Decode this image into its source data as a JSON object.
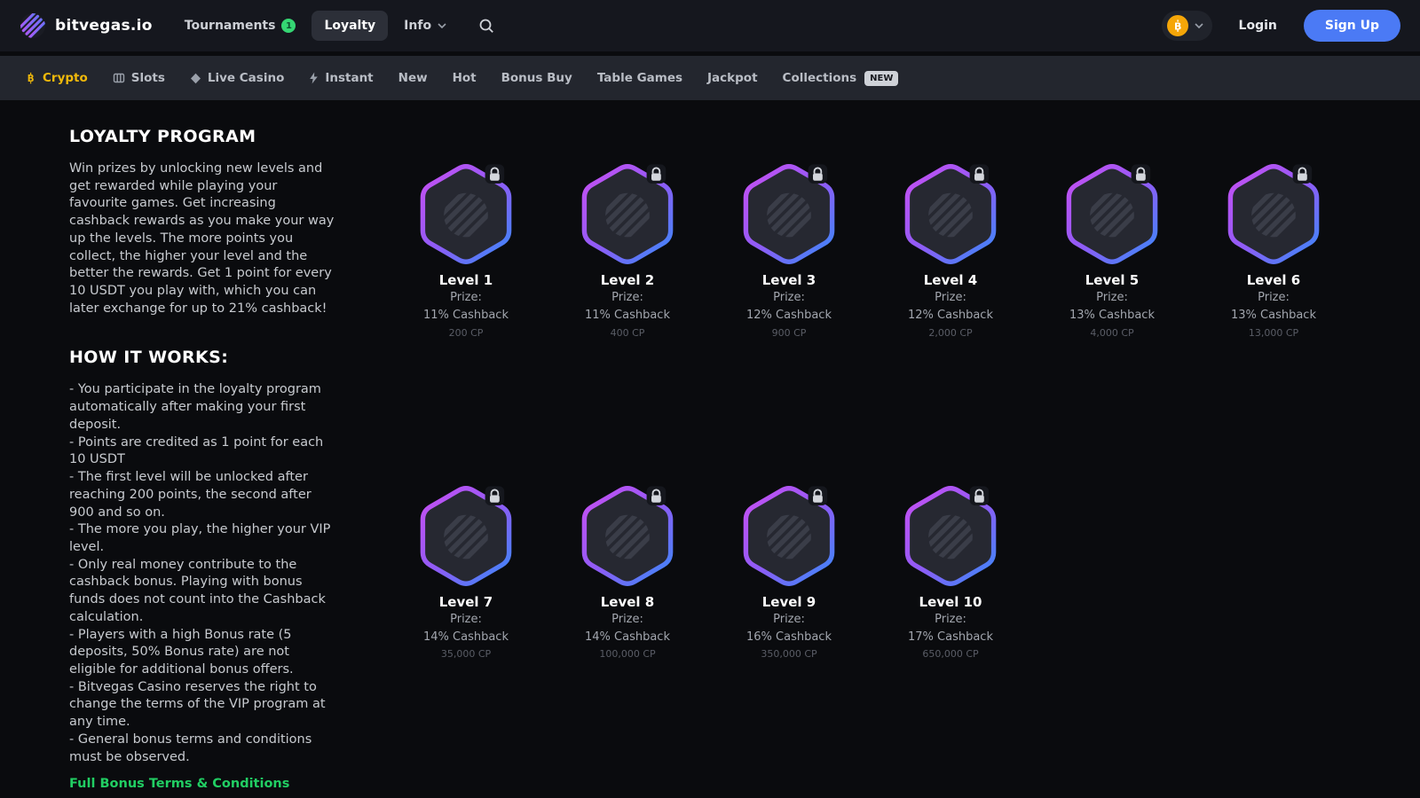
{
  "header": {
    "brand": "bitvegas.io",
    "tournaments_label": "Tournaments",
    "tournaments_badge": "1",
    "loyalty_label": "Loyalty",
    "info_label": "Info",
    "login_label": "Login",
    "signup_label": "Sign Up"
  },
  "subnav": {
    "crypto": "Crypto",
    "slots": "Slots",
    "live_casino": "Live Casino",
    "instant": "Instant",
    "new": "New",
    "hot": "Hot",
    "bonus_buy": "Bonus Buy",
    "table_games": "Table Games",
    "jackpot": "Jackpot",
    "collections": "Collections",
    "collections_badge": "NEW"
  },
  "loyalty_page": {
    "title": "LOYALTY PROGRAM",
    "intro": "Win prizes by unlocking new levels and get rewarded while playing your favourite games. Get increasing cashback rewards as you make your way up the levels. The more points you collect, the higher your level and the better the rewards. Get 1 point for every 10 USDT you play with, which you can later exchange for up to 21% cashback!",
    "how_title": "HOW IT WORKS:",
    "how_items": [
      "- You participate in the loyalty program automatically after making your first deposit.",
      "- Points are credited as 1 point for each 10 USDT",
      "- The first level will be unlocked after reaching 200 points, the second after 900 and so on.",
      "- The more you play, the higher your VIP level.",
      "- Only real money contribute to the cashback bonus. Playing with bonus funds does not count into the Cashback calculation.",
      "- Players with a high Bonus rate (5 deposits, 50% Bonus rate) are not eligible for additional bonus offers.",
      "- Bitvegas Casino reserves the right to change the terms of the VIP program at any time.",
      "- General bonus terms and conditions must be observed."
    ],
    "terms_link": "Full Bonus Terms & Conditions"
  },
  "levels": [
    {
      "name": "Level 1",
      "prize_label": "Prize:",
      "cashback": "11% Cashback",
      "cp": "200 CP"
    },
    {
      "name": "Level 2",
      "prize_label": "Prize:",
      "cashback": "11% Cashback",
      "cp": "400 CP"
    },
    {
      "name": "Level 3",
      "prize_label": "Prize:",
      "cashback": "12% Cashback",
      "cp": "900 CP"
    },
    {
      "name": "Level 4",
      "prize_label": "Prize:",
      "cashback": "12% Cashback",
      "cp": "2,000 CP"
    },
    {
      "name": "Level 5",
      "prize_label": "Prize:",
      "cashback": "13% Cashback",
      "cp": "4,000 CP"
    },
    {
      "name": "Level 6",
      "prize_label": "Prize:",
      "cashback": "13% Cashback",
      "cp": "13,000 CP"
    },
    {
      "name": "Level 7",
      "prize_label": "Prize:",
      "cashback": "14% Cashback",
      "cp": "35,000 CP"
    },
    {
      "name": "Level 8",
      "prize_label": "Prize:",
      "cashback": "14% Cashback",
      "cp": "100,000 CP"
    },
    {
      "name": "Level 9",
      "prize_label": "Prize:",
      "cashback": "16% Cashback",
      "cp": "350,000 CP"
    },
    {
      "name": "Level 10",
      "prize_label": "Prize:",
      "cashback": "17% Cashback",
      "cp": "650,000 CP"
    }
  ],
  "colors": {
    "accent_blue": "#4b7af5",
    "accent_green": "#35d673",
    "gold": "#f0b90b",
    "hex_gradient_purple": "#c94ff2",
    "hex_gradient_blue": "#3f86f8",
    "link_green": "#21ce63"
  }
}
